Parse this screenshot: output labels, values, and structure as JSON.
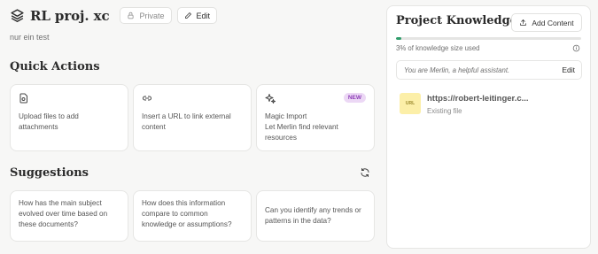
{
  "header": {
    "title": "RL proj. xc",
    "private_label": "Private",
    "edit_label": "Edit",
    "subtitle": "nur ein test"
  },
  "quick_actions": {
    "title": "Quick Actions",
    "cards": [
      {
        "icon": "file-upload-icon",
        "lines": [
          "Upload files to add",
          "attachments"
        ]
      },
      {
        "icon": "link-icon",
        "lines": [
          "Insert a URL to link external",
          "content"
        ]
      },
      {
        "icon": "sparkles-icon",
        "badge": "NEW",
        "lines": [
          "Magic Import",
          "Let Merlin find relevant",
          "resources"
        ]
      }
    ]
  },
  "suggestions": {
    "title": "Suggestions",
    "cards": [
      {
        "lines": [
          "How has the main subject",
          "evolved over time based on",
          "these documents?"
        ]
      },
      {
        "lines": [
          "How does this information",
          "compare to common",
          "knowledge or assumptions?"
        ]
      },
      {
        "lines": [
          "Can you identify any trends or",
          "patterns in the data?"
        ]
      }
    ]
  },
  "knowledge": {
    "title": "Project Knowledge",
    "add_label": "Add Content",
    "usage_percent": 3,
    "usage_text": "3% of knowledge size used",
    "prompt": "You are Merlin, a helpful assistant.",
    "prompt_edit": "Edit",
    "files": [
      {
        "thumb": "URL",
        "name": "https://robert-leitinger.c...",
        "status": "Existing file"
      }
    ]
  },
  "colors": {
    "progress": "#2f9d6b",
    "badge_bg": "#ecd8f5",
    "badge_text": "#8e3fb7",
    "url_thumb": "#fcefa8"
  }
}
